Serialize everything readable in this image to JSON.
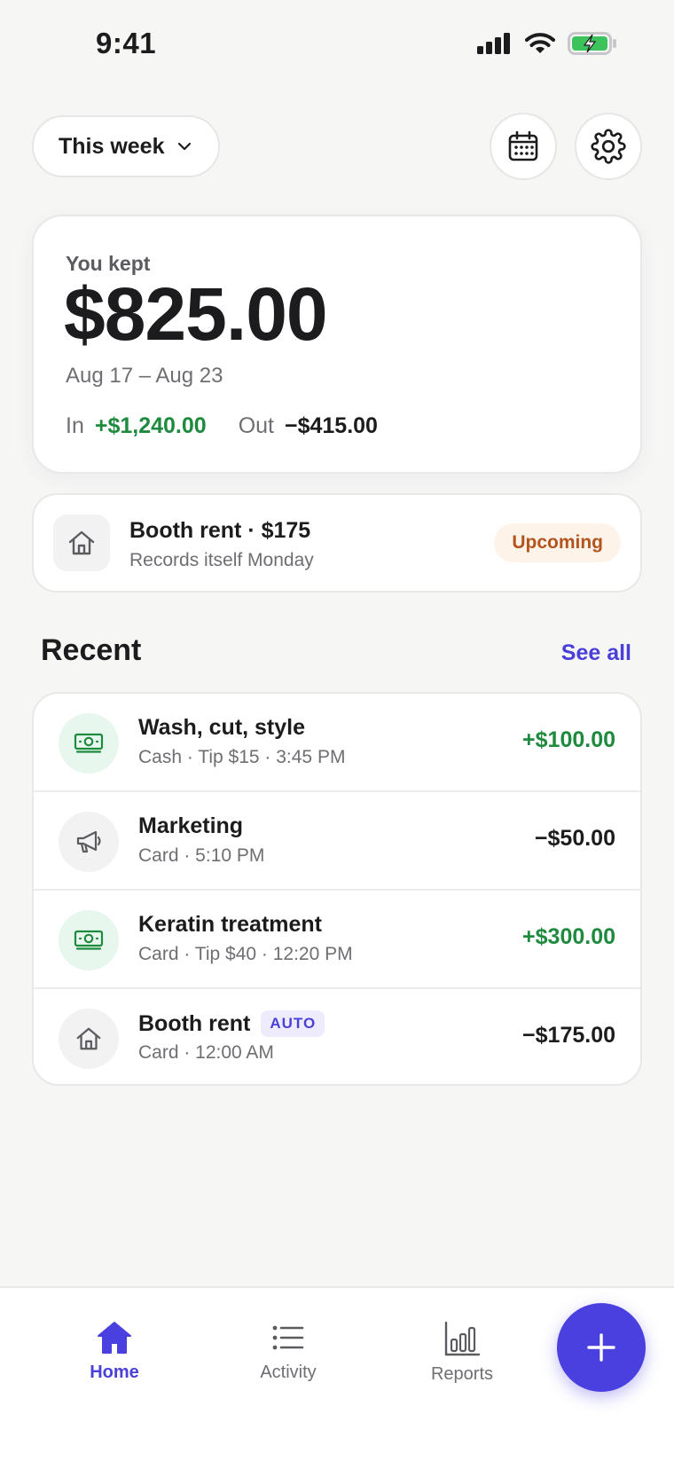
{
  "status_bar": {
    "time": "9:41"
  },
  "header": {
    "period_label": "This week"
  },
  "summary": {
    "kept_label": "You kept",
    "kept_amount": "$825.00",
    "date_range": "Aug 17 – Aug 23",
    "in_label": "In",
    "in_amount": "+$1,240.00",
    "out_label": "Out",
    "out_amount": "−$415.00"
  },
  "upcoming": {
    "title": "Booth rent · $175",
    "subtitle": "Records itself Monday",
    "badge": "Upcoming"
  },
  "recent": {
    "heading": "Recent",
    "see_all": "See all",
    "items": [
      {
        "title": "Wash, cut, style",
        "subtitle": "Cash · Tip $15 · 3:45 PM",
        "amount": "+$100.00",
        "icon": "cash-icon"
      },
      {
        "title": "Marketing",
        "subtitle": "Card · 5:10 PM",
        "amount": "−$50.00",
        "icon": "megaphone-icon"
      },
      {
        "title": "Keratin treatment",
        "subtitle": "Card · Tip $40 · 12:20 PM",
        "amount": "+$300.00",
        "icon": "cash-icon"
      },
      {
        "title": "Booth rent",
        "badge": "AUTO",
        "subtitle": "Card · 12:00 AM",
        "amount": "−$175.00",
        "icon": "house-icon"
      }
    ]
  },
  "nav": {
    "home": "Home",
    "activity": "Activity",
    "reports": "Reports"
  },
  "colors": {
    "accent": "#4a40e0",
    "positive": "#1e8a3e",
    "warning": "#b3541e"
  }
}
